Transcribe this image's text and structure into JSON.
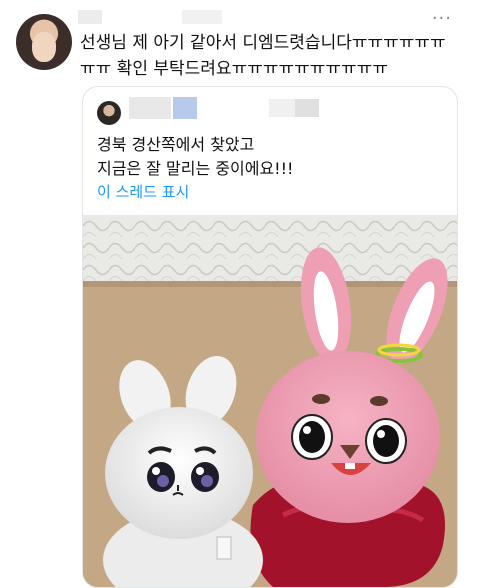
{
  "tweet": {
    "text": "선생님 제 아기 같아서 디엠드렷습니다ㅠㅠㅠㅠㅠㅠㅠㅠ 확인 부탁드려요ㅠㅠㅠㅠㅠㅠㅠㅠㅠㅠ",
    "more_icon": "more-horizontal-icon"
  },
  "quote": {
    "line1": "경북 경산쪽에서 찾았고",
    "line2": "지금은 잘 말리는 중이에요!!!",
    "thread_link": "이 스레드 표시"
  },
  "colors": {
    "link": "#1d9bf0",
    "card_border": "#dfe5ea"
  }
}
